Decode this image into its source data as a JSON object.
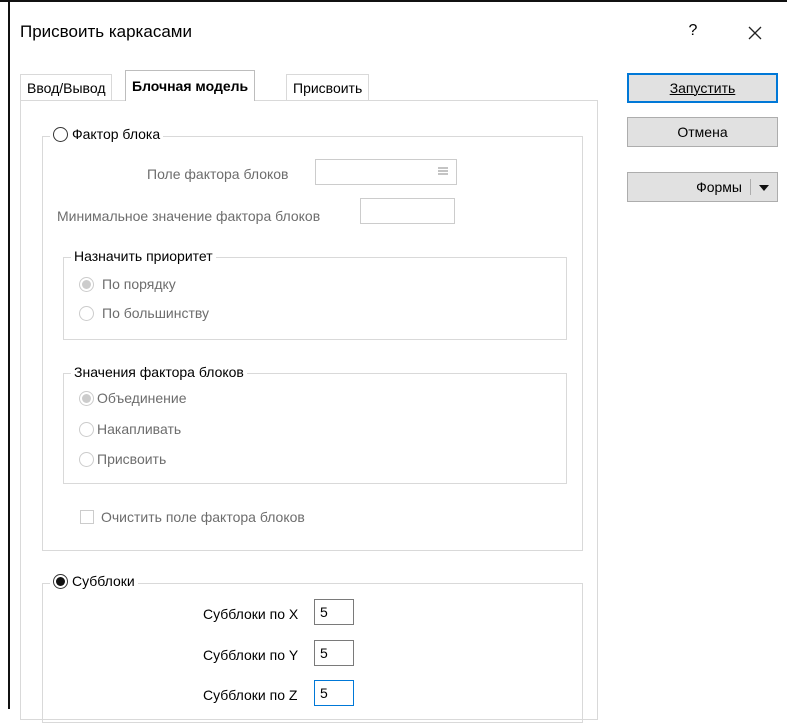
{
  "window": {
    "title": "Присвоить каркасами",
    "help": "?"
  },
  "tabs": [
    {
      "label": "Ввод/Вывод",
      "active": false
    },
    {
      "label": "Блочная модель",
      "active": true
    },
    {
      "label": "Присвоить",
      "active": false
    }
  ],
  "buttons": {
    "run": "Запустить",
    "cancel": "Отмена",
    "forms": "Формы"
  },
  "block_factor": {
    "label": "Фактор блока",
    "selected": false,
    "field_label": "Поле фактора блоков",
    "field_value": "",
    "min_label": "Минимальное значение фактора блоков",
    "min_value": "",
    "priority": {
      "label": "Назначить приоритет",
      "options": [
        "По порядку",
        "По большинству"
      ],
      "selected": "По порядку"
    },
    "values": {
      "label": "Значения фактора блоков",
      "options": [
        "Объединение",
        "Накапливать",
        "Присвоить"
      ],
      "selected": "Объединение"
    },
    "clear_label": "Очистить поле фактора блоков",
    "clear_checked": false
  },
  "subblocks": {
    "label": "Субблоки",
    "selected": true,
    "x_label": "Субблоки по X",
    "x_value": "5",
    "y_label": "Субблоки по Y",
    "y_value": "5",
    "z_label": "Субблоки по Z",
    "z_value": "5"
  },
  "colors": {
    "accent": "#0078d7",
    "disabled_text": "#6d6d6d",
    "button_face": "#e1e1e1"
  }
}
